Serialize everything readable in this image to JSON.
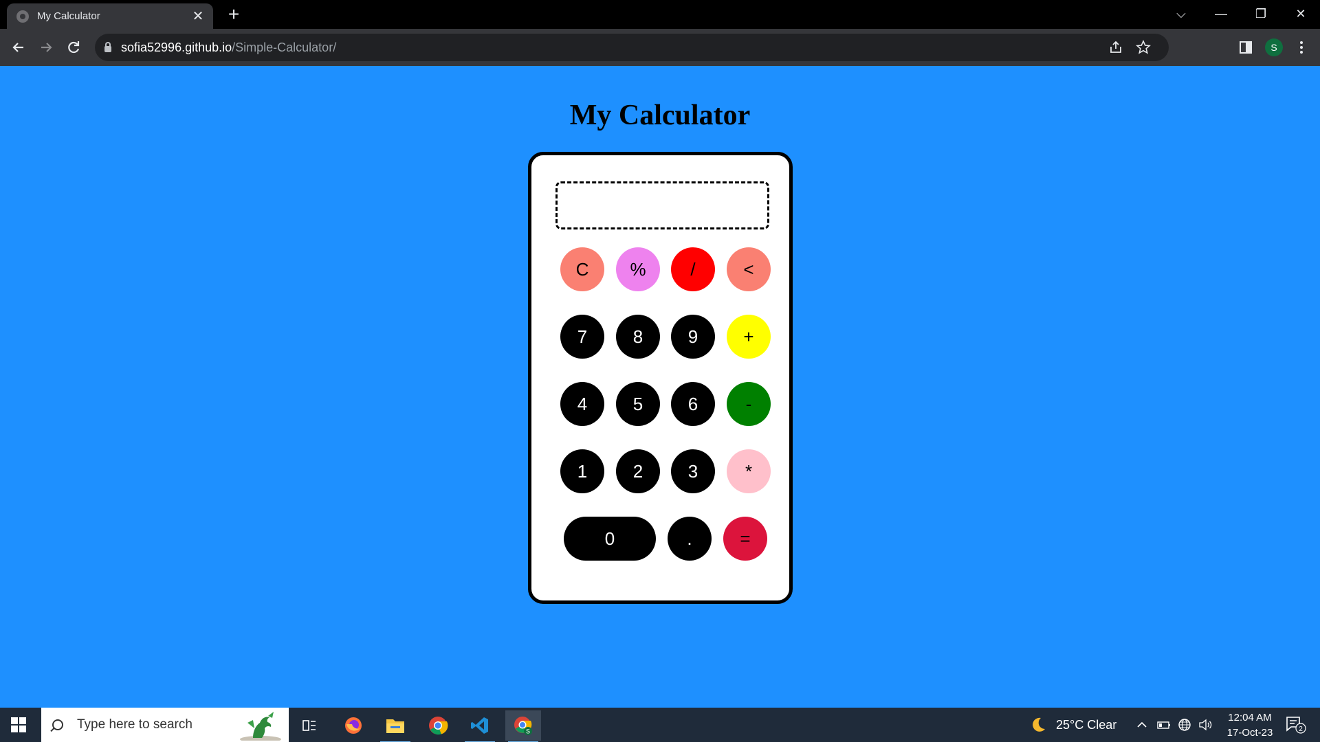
{
  "browser": {
    "tab_title": "My Calculator",
    "tab_close": "✕",
    "new_tab": "+",
    "url_host": "sofia52996.github.io",
    "url_path": "/Simple-Calculator/",
    "profile_initial": "S",
    "window_controls": {
      "tab_search": "⌵",
      "minimize": "—",
      "restore": "❐",
      "close": "✕"
    }
  },
  "page": {
    "title": "My Calculator",
    "display_value": ""
  },
  "calculator": {
    "keys": [
      {
        "label": "C",
        "color": "#fa8072"
      },
      {
        "label": "%",
        "color": "#ee82ee"
      },
      {
        "label": "/",
        "color": "#ff0000"
      },
      {
        "label": "<",
        "color": "#fa8072"
      },
      {
        "label": "7",
        "color": "#000000"
      },
      {
        "label": "8",
        "color": "#000000"
      },
      {
        "label": "9",
        "color": "#000000"
      },
      {
        "label": "+",
        "color": "#ffff00"
      },
      {
        "label": "4",
        "color": "#000000"
      },
      {
        "label": "5",
        "color": "#000000"
      },
      {
        "label": "6",
        "color": "#000000"
      },
      {
        "label": "-",
        "color": "#008000"
      },
      {
        "label": "1",
        "color": "#000000"
      },
      {
        "label": "2",
        "color": "#000000"
      },
      {
        "label": "3",
        "color": "#000000"
      },
      {
        "label": "*",
        "color": "#ffc0cb"
      },
      {
        "label": "0",
        "color": "#000000"
      },
      {
        "label": ".",
        "color": "#000000"
      },
      {
        "label": "=",
        "color": "#dc143c"
      }
    ]
  },
  "taskbar": {
    "search_placeholder": "Type here to search",
    "weather": "25°C  Clear",
    "time": "12:04 AM",
    "date": "17-Oct-23",
    "notification_count": "2"
  },
  "colors": {
    "page_background": "#1e90ff",
    "calculator_border": "#000000"
  }
}
